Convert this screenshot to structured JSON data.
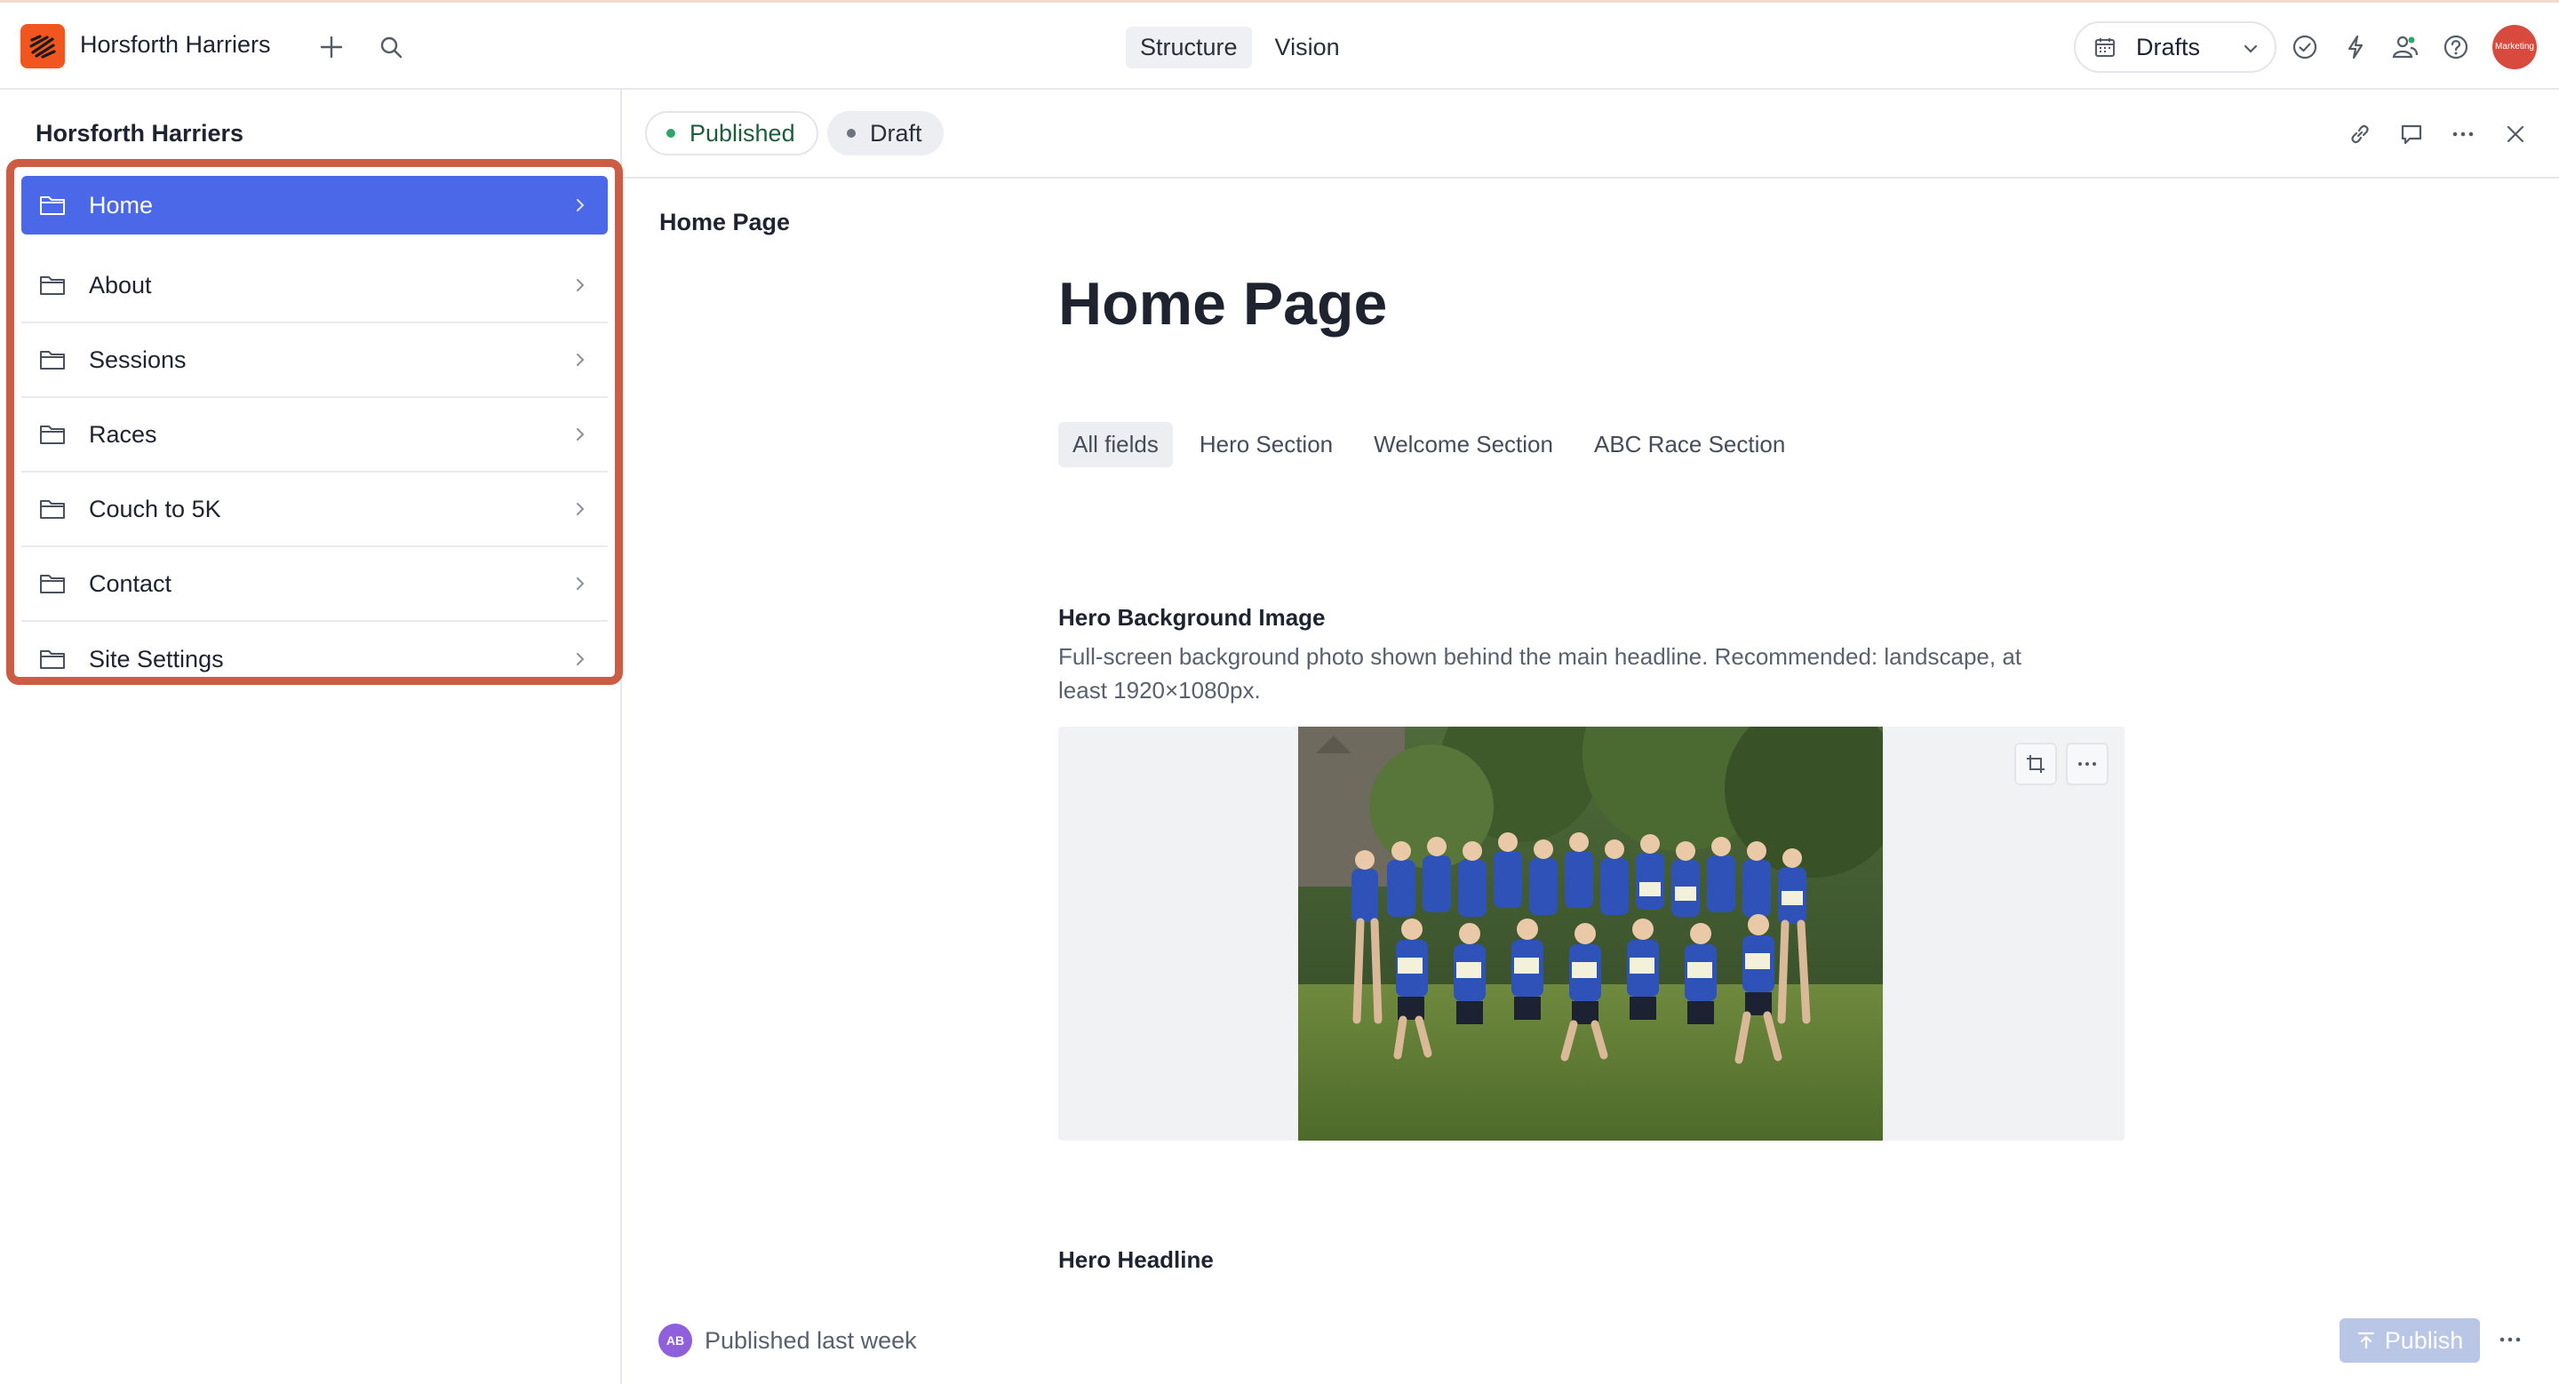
{
  "workspace": {
    "name": "Horsforth Harriers"
  },
  "topbar": {
    "tabs": [
      {
        "label": "Structure",
        "active": true
      },
      {
        "label": "Vision",
        "active": false
      }
    ],
    "release": {
      "label": "Drafts"
    },
    "avatar_text": "Marketing"
  },
  "sidebar": {
    "title": "Horsforth Harriers",
    "items": [
      {
        "label": "Home",
        "active": true
      },
      {
        "label": "About"
      },
      {
        "label": "Sessions"
      },
      {
        "label": "Races"
      },
      {
        "label": "Couch to 5K"
      },
      {
        "label": "Contact"
      },
      {
        "label": "Site Settings"
      }
    ]
  },
  "document": {
    "status_published": "Published",
    "status_draft": "Draft",
    "breadcrumb": "Home Page",
    "title": "Home Page",
    "field_tabs": [
      {
        "label": "All fields",
        "active": true
      },
      {
        "label": "Hero Section"
      },
      {
        "label": "Welcome Section"
      },
      {
        "label": "ABC Race Section"
      }
    ],
    "fields": {
      "hero_image": {
        "label": "Hero Background Image",
        "description": "Full-screen background photo shown behind the main headline. Recommended: landscape, at least 1920×1080px."
      },
      "hero_headline": {
        "label": "Hero Headline"
      }
    }
  },
  "footer": {
    "avatar_initials": "AB",
    "status": "Published last week",
    "publish_label": "Publish"
  },
  "colors": {
    "accent": "#4b68e8",
    "brand": "#f0561d",
    "highlight_border": "#cc5c44",
    "published_dot": "#2fa66a"
  }
}
